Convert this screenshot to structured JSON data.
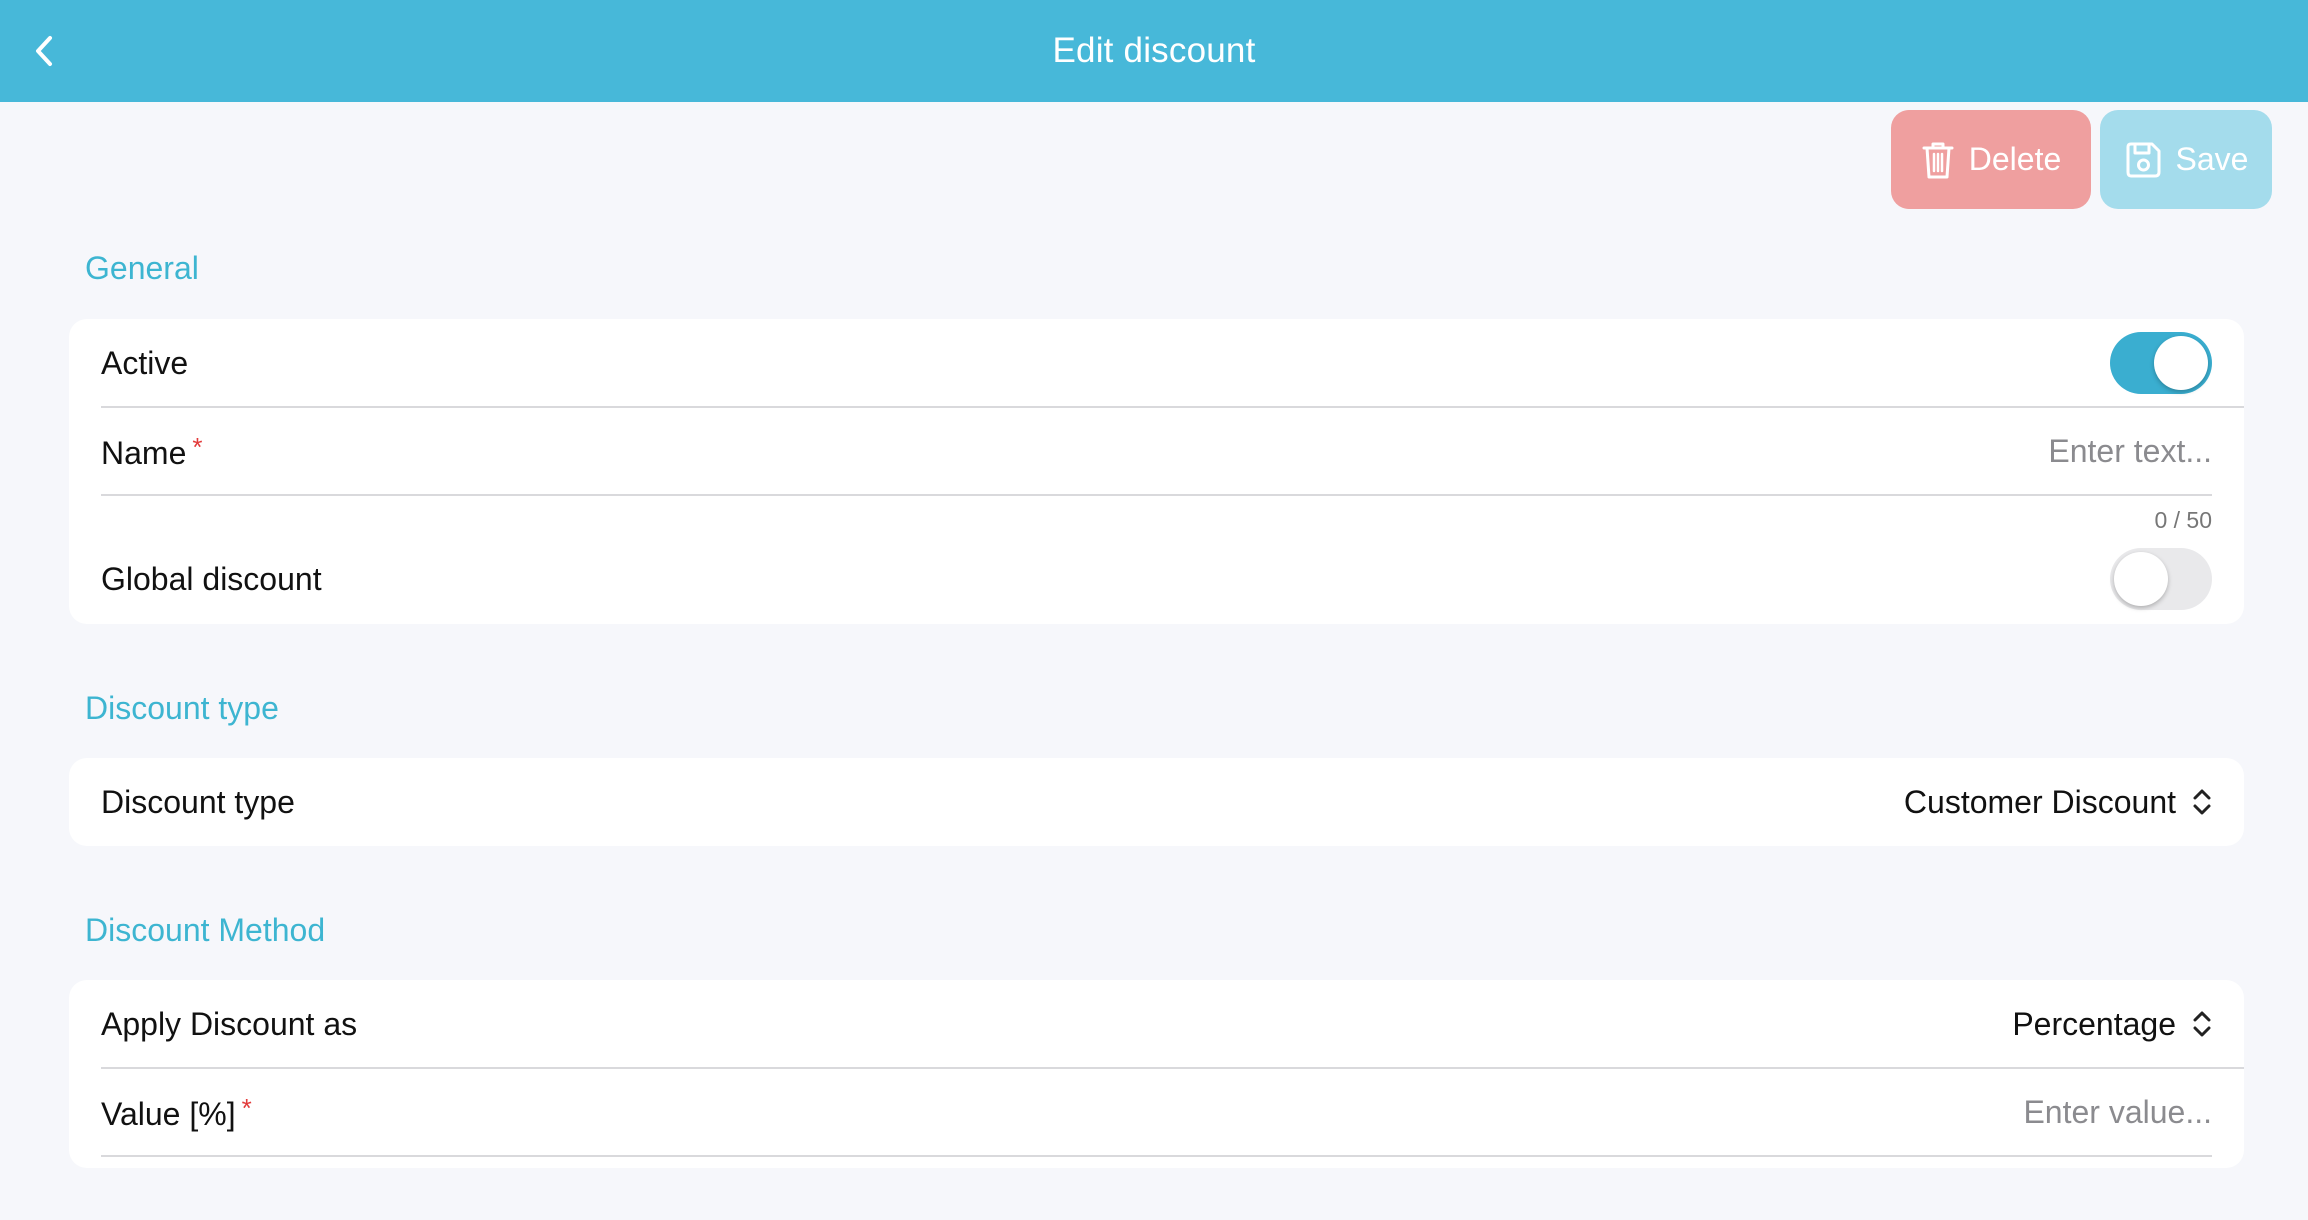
{
  "header": {
    "title": "Edit discount"
  },
  "actions": {
    "delete_label": "Delete",
    "save_label": "Save"
  },
  "sections": {
    "general": {
      "title": "General",
      "active_label": "Active",
      "active_on": true,
      "name_label": "Name",
      "name_required": "*",
      "name_placeholder": "Enter text...",
      "name_counter": "0 / 50",
      "global_label": "Global discount",
      "global_on": false
    },
    "discount_type": {
      "title": "Discount type",
      "label": "Discount type",
      "value": "Customer Discount"
    },
    "discount_method": {
      "title": "Discount Method",
      "apply_label": "Apply Discount as",
      "apply_value": "Percentage",
      "value_label": "Value [%]",
      "value_required": "*",
      "value_placeholder": "Enter value..."
    }
  },
  "colors": {
    "header": "#47b8d9",
    "accent": "#3db5d1",
    "delete": "#ef9f9f",
    "save": "#a4dcec",
    "required": "#e23b3b"
  }
}
